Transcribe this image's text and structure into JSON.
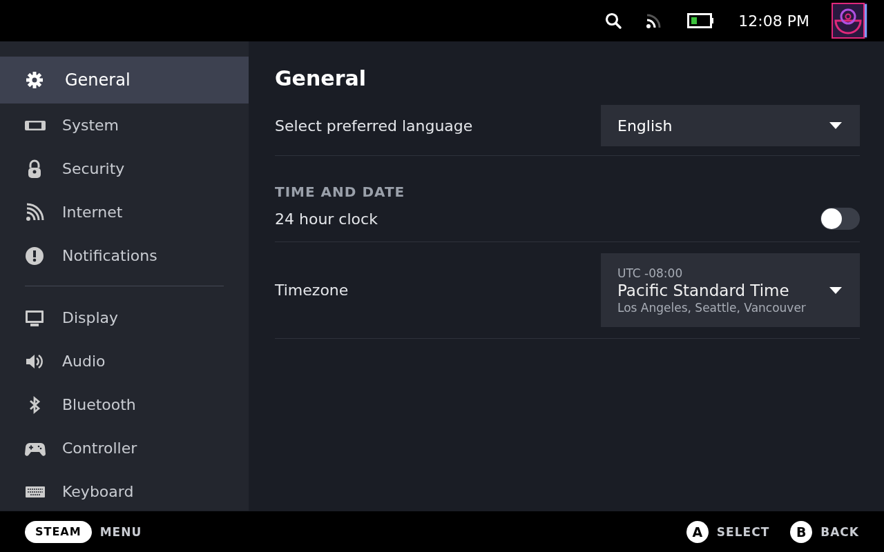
{
  "top_bar": {
    "time": "12:08 PM"
  },
  "sidebar": {
    "groups": [
      [
        {
          "label": "General",
          "selected": true
        },
        {
          "label": "System",
          "selected": false
        },
        {
          "label": "Security",
          "selected": false
        },
        {
          "label": "Internet",
          "selected": false
        },
        {
          "label": "Notifications",
          "selected": false
        }
      ],
      [
        {
          "label": "Display",
          "selected": false
        },
        {
          "label": "Audio",
          "selected": false
        },
        {
          "label": "Bluetooth",
          "selected": false
        },
        {
          "label": "Controller",
          "selected": false
        },
        {
          "label": "Keyboard",
          "selected": false
        }
      ]
    ]
  },
  "page": {
    "title": "General",
    "language": {
      "label": "Select preferred language",
      "value": "English"
    },
    "section": "TIME AND DATE",
    "clock": {
      "label": "24 hour clock",
      "on": false
    },
    "timezone": {
      "label": "Timezone",
      "offset": "UTC -08:00",
      "value": "Pacific Standard Time",
      "cities": "Los Angeles, Seattle, Vancouver"
    }
  },
  "footer": {
    "left": [
      {
        "key": "STEAM",
        "action": "MENU"
      }
    ],
    "right": [
      {
        "key": "A",
        "action": "SELECT"
      },
      {
        "key": "B",
        "action": "BACK"
      }
    ]
  }
}
